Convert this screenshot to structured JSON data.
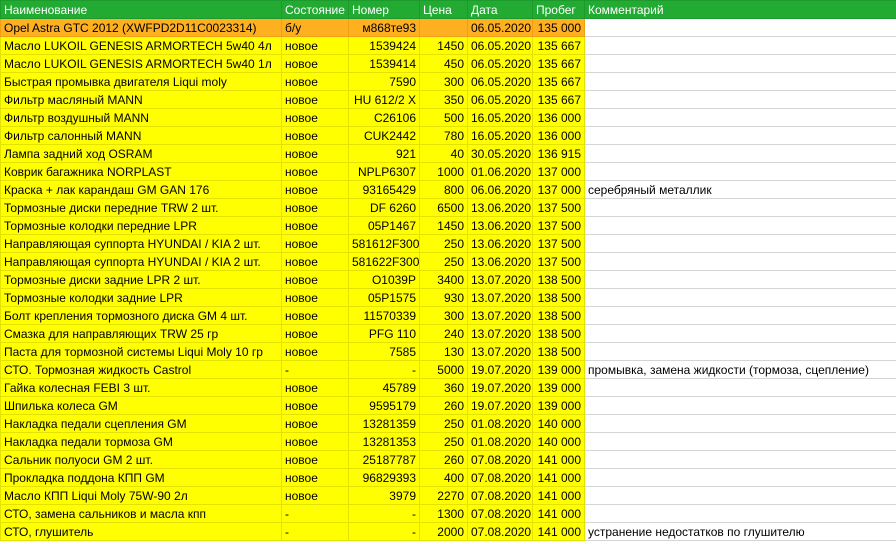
{
  "sheet": {
    "headers": [
      "Наименование",
      "Состояние",
      "Номер",
      "Цена",
      "Дата",
      "Пробег",
      "Комментарий"
    ],
    "rows": [
      {
        "name": "Opel Astra GTC 2012 (XWFPD2D11C0023314)",
        "state": "б/у",
        "number": "м868те93",
        "price": "",
        "date": "06.05.2020",
        "mileage": "135 000",
        "comment": ""
      },
      {
        "name": "Масло LUKOIL GENESIS ARMORTECH 5w40 4л",
        "state": "новое",
        "number": "1539424",
        "price": "1450",
        "date": "06.05.2020",
        "mileage": "135 667",
        "comment": ""
      },
      {
        "name": "Масло LUKOIL GENESIS ARMORTECH 5w40 1л",
        "state": "новое",
        "number": "1539414",
        "price": "450",
        "date": "06.05.2020",
        "mileage": "135 667",
        "comment": ""
      },
      {
        "name": "Быстрая промывка двигателя Liqui moly",
        "state": "новое",
        "number": "7590",
        "price": "300",
        "date": "06.05.2020",
        "mileage": "135 667",
        "comment": ""
      },
      {
        "name": "Фильтр масляный MANN",
        "state": "новое",
        "number": "HU 612/2 X",
        "price": "350",
        "date": "06.05.2020",
        "mileage": "135 667",
        "comment": ""
      },
      {
        "name": "Фильтр воздушный MANN",
        "state": "новое",
        "number": "C26106",
        "price": "500",
        "date": "16.05.2020",
        "mileage": "136 000",
        "comment": ""
      },
      {
        "name": "Фильтр салонный MANN",
        "state": "новое",
        "number": "CUK2442",
        "price": "780",
        "date": "16.05.2020",
        "mileage": "136 000",
        "comment": ""
      },
      {
        "name": "Лампа задний ход OSRAM",
        "state": "новое",
        "number": "921",
        "price": "40",
        "date": "30.05.2020",
        "mileage": "136 915",
        "comment": ""
      },
      {
        "name": "Коврик багажника NORPLAST",
        "state": "новое",
        "number": "NPLP6307",
        "price": "1000",
        "date": "01.06.2020",
        "mileage": "137 000",
        "comment": ""
      },
      {
        "name": "Краска + лак карандаш GM GAN 176",
        "state": "новое",
        "number": "93165429",
        "price": "800",
        "date": "06.06.2020",
        "mileage": "137 000",
        "comment": "серебряный металлик"
      },
      {
        "name": "Тормозные диски передние TRW 2 шт.",
        "state": "новое",
        "number": "DF 6260",
        "price": "6500",
        "date": "13.06.2020",
        "mileage": "137 500",
        "comment": ""
      },
      {
        "name": "Тормозные колодки передние LPR",
        "state": "новое",
        "number": "05P1467",
        "price": "1450",
        "date": "13.06.2020",
        "mileage": "137 500",
        "comment": ""
      },
      {
        "name": "Направляющая суппорта HYUNDAI / KIA 2 шт.",
        "state": "новое",
        "number": "581612F300",
        "price": "250",
        "date": "13.06.2020",
        "mileage": "137 500",
        "comment": ""
      },
      {
        "name": "Направляющая суппорта HYUNDAI / KIA 2 шт.",
        "state": "новое",
        "number": "581622F300",
        "price": "250",
        "date": "13.06.2020",
        "mileage": "137 500",
        "comment": ""
      },
      {
        "name": "Тормозные диски задние LPR 2 шт.",
        "state": "новое",
        "number": "O1039P",
        "price": "3400",
        "date": "13.07.2020",
        "mileage": "138 500",
        "comment": ""
      },
      {
        "name": "Тормозные колодки задние LPR",
        "state": "новое",
        "number": "05P1575",
        "price": "930",
        "date": "13.07.2020",
        "mileage": "138 500",
        "comment": ""
      },
      {
        "name": "Болт крепления тормозного диска GM 4 шт.",
        "state": "новое",
        "number": "11570339",
        "price": "300",
        "date": "13.07.2020",
        "mileage": "138 500",
        "comment": ""
      },
      {
        "name": "Смазка для направляющих TRW 25 гр",
        "state": "новое",
        "number": "PFG 110",
        "price": "240",
        "date": "13.07.2020",
        "mileage": "138 500",
        "comment": ""
      },
      {
        "name": "Паста для тормозной системы Liqui Moly 10 гр",
        "state": "новое",
        "number": "7585",
        "price": "130",
        "date": "13.07.2020",
        "mileage": "138 500",
        "comment": ""
      },
      {
        "name": "СТО. Тормозная жидкость Castrol",
        "state": "-",
        "number": "-",
        "price": "5000",
        "date": "19.07.2020",
        "mileage": "139 000",
        "comment": "промывка, замена жидкости (тормоза, сцепление)"
      },
      {
        "name": "Гайка колесная FEBI 3 шт.",
        "state": "новое",
        "number": "45789",
        "price": "360",
        "date": "19.07.2020",
        "mileage": "139 000",
        "comment": ""
      },
      {
        "name": "Шпилька колеса GM",
        "state": "новое",
        "number": "9595179",
        "price": "260",
        "date": "19.07.2020",
        "mileage": "139 000",
        "comment": ""
      },
      {
        "name": "Накладка педали сцепления GM",
        "state": "новое",
        "number": "13281359",
        "price": "250",
        "date": "01.08.2020",
        "mileage": "140 000",
        "comment": ""
      },
      {
        "name": "Накладка педали тормоза GM",
        "state": "новое",
        "number": "13281353",
        "price": "250",
        "date": "01.08.2020",
        "mileage": "140 000",
        "comment": ""
      },
      {
        "name": "Сальник полуоси GM 2 шт.",
        "state": "новое",
        "number": "25187787",
        "price": "260",
        "date": "07.08.2020",
        "mileage": "141 000",
        "comment": ""
      },
      {
        "name": "Прокладка поддона КПП GM",
        "state": "новое",
        "number": "96829393",
        "price": "400",
        "date": "07.08.2020",
        "mileage": "141 000",
        "comment": ""
      },
      {
        "name": "Масло КПП Liqui Moly 75W-90 2л",
        "state": "новое",
        "number": "3979",
        "price": "2270",
        "date": "07.08.2020",
        "mileage": "141 000",
        "comment": ""
      },
      {
        "name": "СТО, замена сальников и масла кпп",
        "state": "-",
        "number": "-",
        "price": "1300",
        "date": "07.08.2020",
        "mileage": "141 000",
        "comment": ""
      },
      {
        "name": "СТО, глушитель",
        "state": "-",
        "number": "-",
        "price": "2000",
        "date": "07.08.2020",
        "mileage": "141 000",
        "comment": "устранение недостатков по глушителю"
      }
    ]
  }
}
